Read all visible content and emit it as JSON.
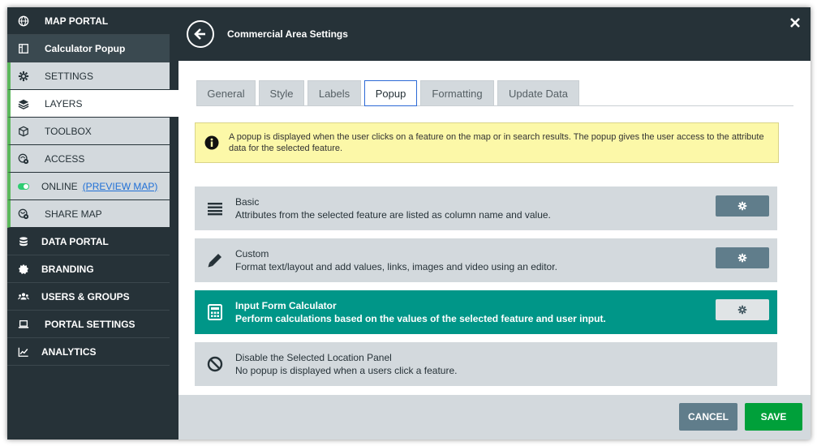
{
  "sidebar": {
    "items": [
      {
        "label": "MAP PORTAL",
        "icon": "globe-icon"
      },
      {
        "label": "Calculator Popup",
        "icon": "map-frame-icon"
      },
      {
        "label": "SETTINGS",
        "icon": "gear-icon"
      },
      {
        "label": "LAYERS",
        "icon": "layers-icon"
      },
      {
        "label": "TOOLBOX",
        "icon": "cube-icon"
      },
      {
        "label": "ACCESS",
        "icon": "globe-eye-icon"
      },
      {
        "label": "ONLINE",
        "link": "(PREVIEW MAP)",
        "icon": "toggle-icon"
      },
      {
        "label": "SHARE MAP",
        "icon": "globe-share-icon"
      },
      {
        "label": "DATA PORTAL",
        "icon": "database-icon"
      },
      {
        "label": "BRANDING",
        "icon": "badge-icon"
      },
      {
        "label": "USERS & GROUPS",
        "icon": "users-icon"
      },
      {
        "label": "PORTAL SETTINGS",
        "icon": "laptop-icon"
      },
      {
        "label": "ANALYTICS",
        "icon": "chart-icon"
      }
    ]
  },
  "header": {
    "title": "Commercial Area Settings"
  },
  "tabs": [
    {
      "label": "General"
    },
    {
      "label": "Style"
    },
    {
      "label": "Labels"
    },
    {
      "label": "Popup",
      "active": true
    },
    {
      "label": "Formatting"
    },
    {
      "label": "Update Data"
    }
  ],
  "info": {
    "text": "A popup is displayed when the user clicks on a feature on the map or in search results. The popup gives the user access to the attribute data for the selected feature."
  },
  "options": [
    {
      "name": "Basic",
      "desc": "Attributes from the selected feature are listed as column name and value.",
      "icon": "list-icon",
      "has_settings": true
    },
    {
      "name": "Custom",
      "desc": "Format text/layout and add values, links, images and video using an editor.",
      "icon": "pencil-icon",
      "has_settings": true
    },
    {
      "name": "Input Form Calculator",
      "desc": "Perform calculations based on the values of the selected feature and user input.",
      "icon": "calculator-icon",
      "has_settings": true,
      "selected": true
    },
    {
      "name": "Disable the Selected Location Panel",
      "desc": "No popup is displayed when a users click a feature.",
      "icon": "ban-icon",
      "has_settings": false
    }
  ],
  "footer": {
    "cancel_label": "CANCEL",
    "save_label": "SAVE"
  },
  "colors": {
    "sidebar_bg": "#263238",
    "selected_option": "#009688",
    "save": "#00a03a",
    "cancel": "#607d8b",
    "info_bg": "#fcf8a8"
  }
}
